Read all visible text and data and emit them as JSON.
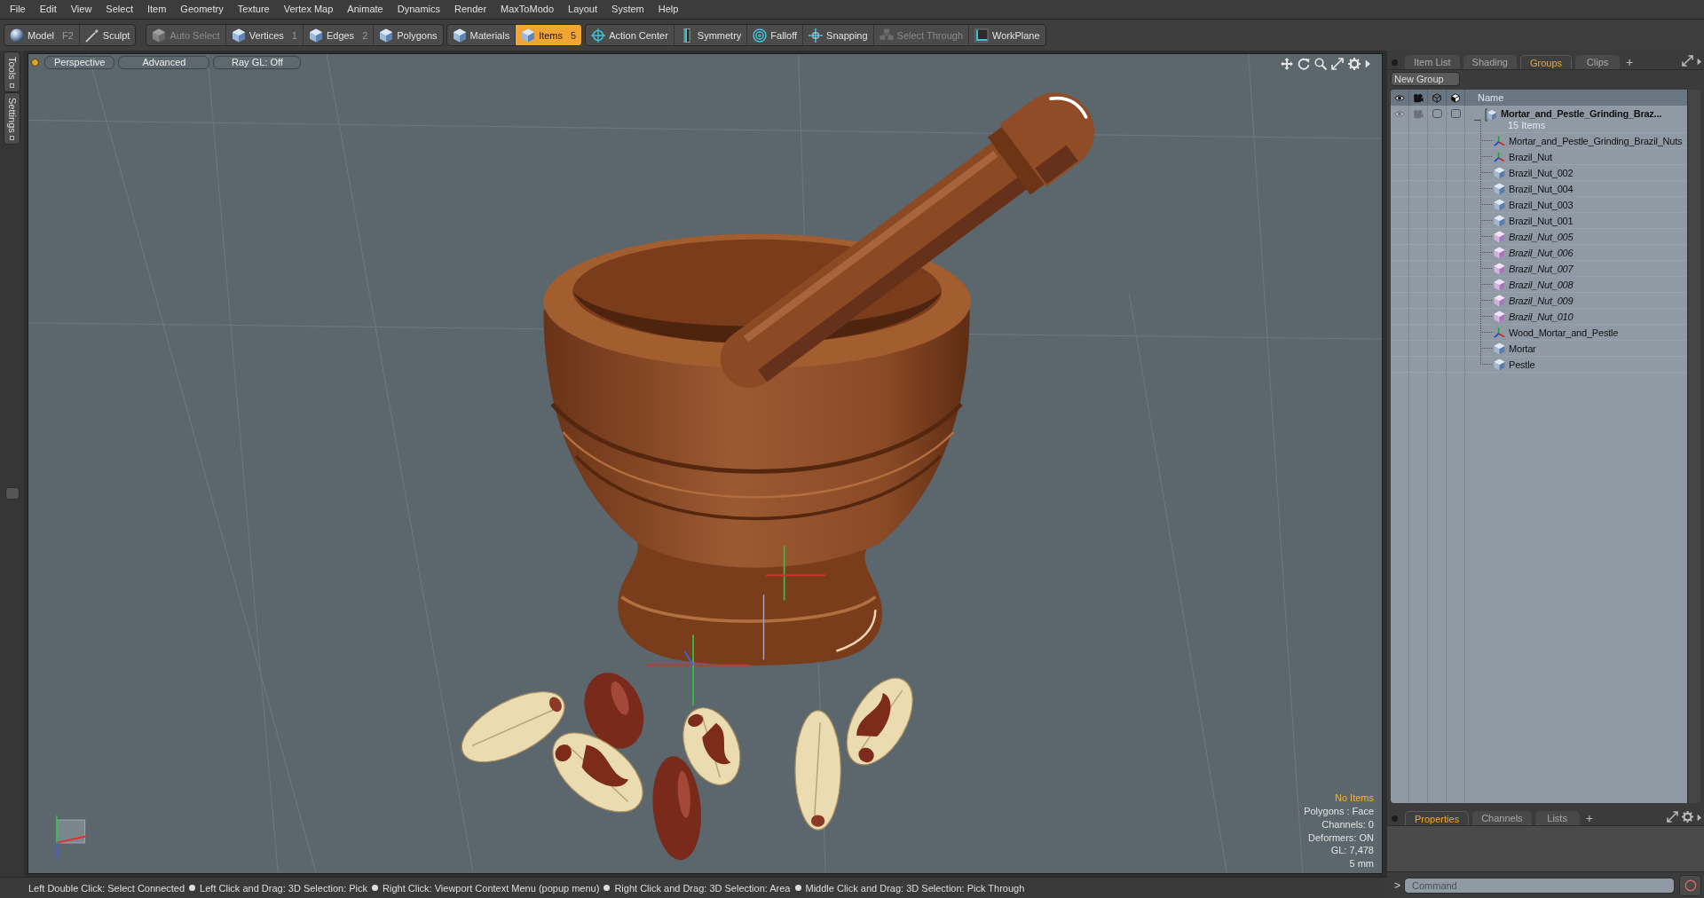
{
  "menu_bar": [
    "File",
    "Edit",
    "View",
    "Select",
    "Item",
    "Geometry",
    "Texture",
    "Vertex Map",
    "Animate",
    "Dynamics",
    "Render",
    "MaxToModo",
    "Layout",
    "System",
    "Help"
  ],
  "toolbar": {
    "groups": [
      [
        {
          "label": "Model",
          "kind": "model",
          "shortcut": "F2",
          "selected": false,
          "disabled": false
        },
        {
          "label": "Sculpt",
          "kind": "sculpt",
          "selected": false,
          "disabled": false
        }
      ],
      [
        {
          "label": "Auto Select",
          "kind": "component",
          "selected": false,
          "disabled": true
        },
        {
          "label": "Vertices",
          "kind": "component",
          "shortcut": "1",
          "selected": false,
          "disabled": false
        },
        {
          "label": "Edges",
          "kind": "component",
          "shortcut": "2",
          "selected": false,
          "disabled": false
        },
        {
          "label": "Polygons",
          "kind": "component",
          "selected": false,
          "disabled": false
        }
      ],
      [
        {
          "label": "Materials",
          "kind": "component",
          "selected": false,
          "disabled": false
        },
        {
          "label": "Items",
          "kind": "component",
          "shortcut": "5",
          "selected": true,
          "disabled": false
        }
      ],
      [
        {
          "label": "Action Center",
          "kind": "center",
          "selected": false,
          "disabled": false
        },
        {
          "label": "Symmetry",
          "kind": "symmetry",
          "selected": false,
          "disabled": false
        },
        {
          "label": "Falloff",
          "kind": "falloff",
          "selected": false,
          "disabled": false
        },
        {
          "label": "Snapping",
          "kind": "snapping",
          "selected": false,
          "disabled": false
        },
        {
          "label": "Select Through",
          "kind": "through",
          "selected": false,
          "disabled": true
        },
        {
          "label": "WorkPlane",
          "kind": "workplane",
          "selected": false,
          "disabled": false
        }
      ]
    ]
  },
  "side_tabs": [
    "Tools",
    "Settings"
  ],
  "viewport": {
    "buttons": [
      "Perspective",
      "Advanced",
      "Ray GL: Off"
    ],
    "info": [
      {
        "text": "No Items",
        "highlighted": true
      },
      {
        "text": "Polygons : Face",
        "highlighted": false
      },
      {
        "text": "Channels: 0",
        "highlighted": false
      },
      {
        "text": "Deformers: ON",
        "highlighted": false
      },
      {
        "text": "GL: 7,478",
        "highlighted": false
      },
      {
        "text": "5 mm",
        "highlighted": false
      }
    ]
  },
  "status_bar": {
    "hints": [
      "Left Double Click: Select Connected",
      "Left Click and Drag: 3D Selection: Pick",
      "Right Click: Viewport Context Menu (popup menu)",
      "Right Click and Drag: 3D Selection: Area",
      "Middle Click and Drag: 3D Selection: Pick Through"
    ]
  },
  "item_panel": {
    "tabs": [
      {
        "label": "Item List",
        "selected": false
      },
      {
        "label": "Shading",
        "selected": false
      },
      {
        "label": "Groups",
        "selected": true
      },
      {
        "label": "Clips",
        "selected": false
      }
    ],
    "add_tab": "+",
    "new_group_button": "New Group",
    "name_column": "Name",
    "group": {
      "name": "Mortar_and_Pestle_Grinding_Braz...",
      "count": "15 Items",
      "expanded": true,
      "children": [
        {
          "name": "Mortar_and_Pestle_Grinding_Brazil_Nuts",
          "kind": "locator"
        },
        {
          "name": "Brazil_Nut",
          "kind": "locator"
        },
        {
          "name": "Brazil_Nut_002",
          "kind": "mesh"
        },
        {
          "name": "Brazil_Nut_004",
          "kind": "mesh"
        },
        {
          "name": "Brazil_Nut_003",
          "kind": "mesh"
        },
        {
          "name": "Brazil_Nut_001",
          "kind": "mesh"
        },
        {
          "name": "Brazil_Nut_005",
          "kind": "instance"
        },
        {
          "name": "Brazil_Nut_006",
          "kind": "instance"
        },
        {
          "name": "Brazil_Nut_007",
          "kind": "instance"
        },
        {
          "name": "Brazil_Nut_008",
          "kind": "instance"
        },
        {
          "name": "Brazil_Nut_009",
          "kind": "instance"
        },
        {
          "name": "Brazil_Nut_010",
          "kind": "instance"
        },
        {
          "name": "Wood_Mortar_and_Pestle",
          "kind": "locator"
        },
        {
          "name": "Mortar",
          "kind": "mesh"
        },
        {
          "name": "Pestle",
          "kind": "mesh"
        }
      ]
    }
  },
  "properties_panel": {
    "tabs": [
      {
        "label": "Properties",
        "selected": true
      },
      {
        "label": "Channels",
        "selected": false
      },
      {
        "label": "Lists",
        "selected": false
      }
    ],
    "add_tab": "+"
  },
  "command_bar": {
    "prompt": ">",
    "placeholder": "Command"
  }
}
